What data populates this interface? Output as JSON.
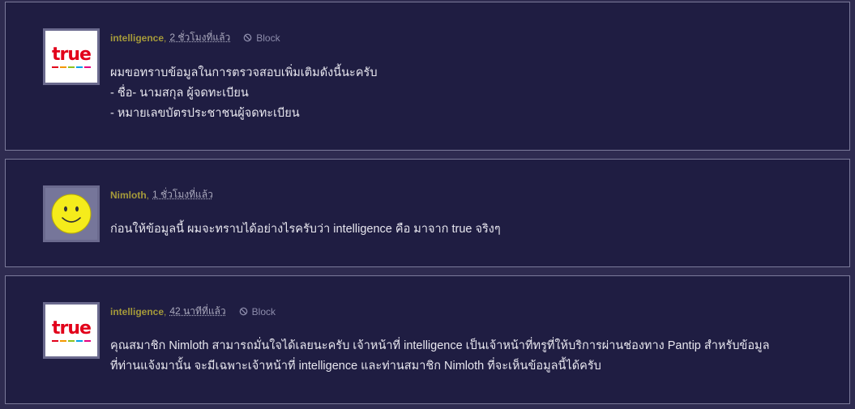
{
  "comments": [
    {
      "author": "intelligence",
      "time": "2 ชั่วโมงที่แล้ว",
      "block_label": "Block",
      "avatar": "true-logo",
      "lines": [
        "ผมขอทราบข้อมูลในการตรวจสอบเพิ่มเติมดังนี้นะครับ",
        "- ชื่อ- นามสกุล ผู้จดทะเบียน",
        "- หมายเลขบัตรประชาชนผู้จดทะเบียน"
      ]
    },
    {
      "author": "Nimloth",
      "time": "1 ชั่วโมงที่แล้ว",
      "avatar": "smiley",
      "lines": [
        "ก่อนให้ข้อมูลนี้ ผมจะทราบได้อย่างไรครับว่า intelligence คือ มาจาก true จริงๆ"
      ]
    },
    {
      "author": "intelligence",
      "time": "42 นาทีที่แล้ว",
      "block_label": "Block",
      "avatar": "true-logo",
      "lines": [
        "คุณสมาชิก Nimloth สามารถมั่นใจได้เลยนะครับ เจ้าหน้าที่ intelligence เป็นเจ้าหน้าที่ทรูที่ให้บริการผ่านช่องทาง Pantip สำหรับข้อมูล",
        "ที่ท่านแจ้งมานั้น จะมีเฉพาะเจ้าหน้าที่ intelligence และท่านสมาชิก Nimloth ที่จะเห็นข้อมูลนี้ได้ครับ"
      ]
    }
  ],
  "logo": {
    "word": "true",
    "brand_color": "#e2001a"
  },
  "colors": {
    "background": "#2e2b50",
    "card": "#1f1d42",
    "author": "#a59a3a"
  }
}
